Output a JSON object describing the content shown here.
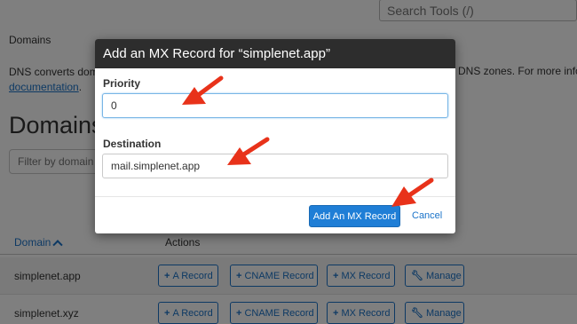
{
  "search": {
    "placeholder": "Search Tools (/)"
  },
  "breadcrumb": "Domains",
  "description": {
    "left_text": "DNS converts dom",
    "link_text": "documentation",
    "link_suffix": ".",
    "right_text": "DNS zones. For more info"
  },
  "page_title": "Domains",
  "filter": {
    "placeholder": "Filter by domain"
  },
  "table": {
    "columns": [
      "Domain",
      "Actions"
    ],
    "rows": [
      {
        "domain": "simplenet.app",
        "actions": [
          "A Record",
          "CNAME Record",
          "MX Record",
          "Manage"
        ]
      },
      {
        "domain": "simplenet.xyz",
        "actions": [
          "A Record",
          "CNAME Record",
          "MX Record",
          "Manage"
        ]
      }
    ],
    "action_icons": [
      "plus-icon",
      "plus-icon",
      "plus-icon",
      "wrench-icon"
    ]
  },
  "modal": {
    "title": "Add an MX Record for “simplenet.app”",
    "priority_label": "Priority",
    "priority_value": "0",
    "destination_label": "Destination",
    "destination_value": "mail.simplenet.app",
    "submit_label": "Add An MX Record",
    "cancel_label": "Cancel"
  },
  "colors": {
    "accent": "#1a73c9",
    "primary_button": "#1f7ed6",
    "modal_header": "#2d2d2d",
    "annotation_arrow": "#e8321a"
  }
}
